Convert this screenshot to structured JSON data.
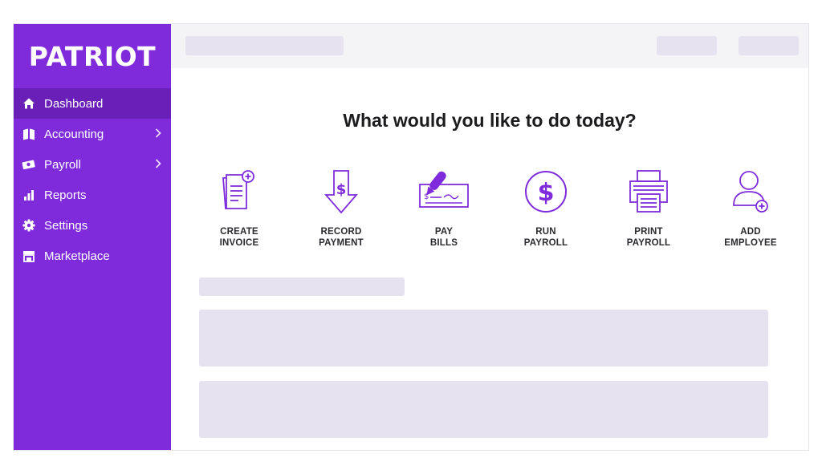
{
  "brand": {
    "logo_text": "PATRIOT",
    "accent": "#7f2bdb",
    "accent_dark": "#6a1fb8"
  },
  "sidebar": {
    "items": [
      {
        "label": "Dashboard",
        "icon": "home-icon",
        "active": true,
        "has_submenu": false
      },
      {
        "label": "Accounting",
        "icon": "book-icon",
        "active": false,
        "has_submenu": true
      },
      {
        "label": "Payroll",
        "icon": "money-icon",
        "active": false,
        "has_submenu": true
      },
      {
        "label": "Reports",
        "icon": "bar-chart-icon",
        "active": false,
        "has_submenu": false
      },
      {
        "label": "Settings",
        "icon": "gear-icon",
        "active": false,
        "has_submenu": false
      },
      {
        "label": "Marketplace",
        "icon": "storefront-icon",
        "active": false,
        "has_submenu": false
      }
    ]
  },
  "main": {
    "heading": "What would you like to do today?",
    "actions": [
      {
        "label": "CREATE\nINVOICE",
        "icon": "invoice-icon"
      },
      {
        "label": "RECORD\nPAYMENT",
        "icon": "record-payment-icon"
      },
      {
        "label": "PAY\nBILLS",
        "icon": "check-pen-icon"
      },
      {
        "label": "RUN\nPAYROLL",
        "icon": "dollar-circle-icon"
      },
      {
        "label": "PRINT\nPAYROLL",
        "icon": "printer-icon"
      },
      {
        "label": "ADD\nEMPLOYEE",
        "icon": "add-user-icon"
      }
    ]
  }
}
